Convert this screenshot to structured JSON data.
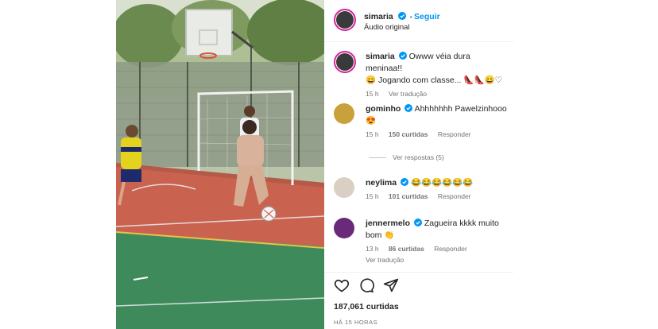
{
  "header": {
    "username": "simaria",
    "follow_label": "Seguir",
    "audio_label": "Áudio original"
  },
  "caption": {
    "username": "simaria",
    "text_line1": "Owww véia dura meninaa!!",
    "text_line2": "😄 Jogando com classe... 👠👠😄♡",
    "time": "15 h",
    "translate_label": "Ver tradução"
  },
  "comments": [
    {
      "username": "gominho",
      "text": "Ahhhhhhh Pawelzinhooo😍",
      "time": "15 h",
      "likes": "150 curtidas",
      "reply_label": "Responder",
      "view_replies": "Ver respostas (5)"
    },
    {
      "username": "neylima",
      "text": "😂😂😂😂😂😂",
      "time": "15 h",
      "likes": "101 curtidas",
      "reply_label": "Responder"
    },
    {
      "username": "jennermelo",
      "text": "Zagueira kkkk muito bom 👏",
      "time": "13 h",
      "likes": "86 curtidas",
      "reply_label": "Responder",
      "translate_label": "Ver tradução"
    }
  ],
  "footer": {
    "likes_total": "187,061 curtidas",
    "posted_ago": "HÁ 15 HORAS"
  },
  "colors": {
    "accent": "#0095f6",
    "story_ring": "#d6249f",
    "court_red": "#c9634f",
    "court_green": "#3f8a5a"
  },
  "icons": [
    "verified-badge-icon",
    "heart-icon",
    "comment-icon",
    "share-icon"
  ]
}
